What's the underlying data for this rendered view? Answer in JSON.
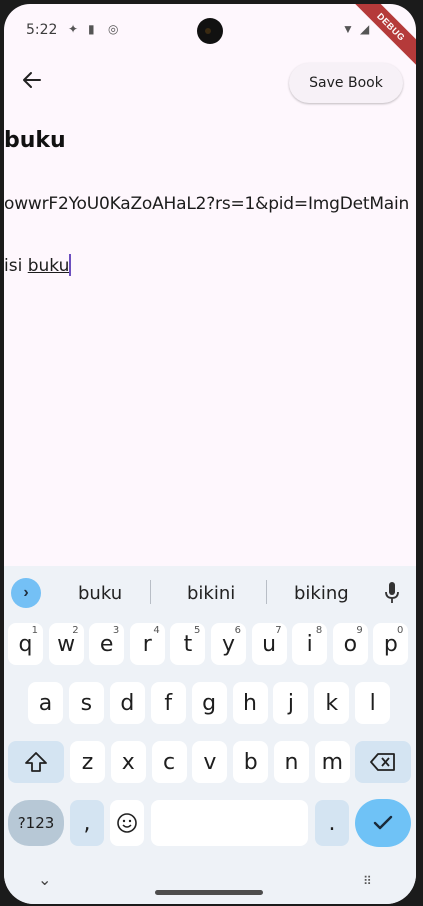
{
  "status_bar": {
    "time": "5:22",
    "debug_label": "DEBUG"
  },
  "appbar": {
    "save_label": "Save Book"
  },
  "book": {
    "title": "buku",
    "image_url": "owwrF2YoU0KaZoAHaL2?rs=1&pid=ImgDetMain",
    "content_prefix": "isi ",
    "content_word": "buku"
  },
  "keyboard": {
    "suggestions": [
      "buku",
      "bikini",
      "biking"
    ],
    "row1": [
      {
        "k": "q",
        "h": "1"
      },
      {
        "k": "w",
        "h": "2"
      },
      {
        "k": "e",
        "h": "3"
      },
      {
        "k": "r",
        "h": "4"
      },
      {
        "k": "t",
        "h": "5"
      },
      {
        "k": "y",
        "h": "6"
      },
      {
        "k": "u",
        "h": "7"
      },
      {
        "k": "i",
        "h": "8"
      },
      {
        "k": "o",
        "h": "9"
      },
      {
        "k": "p",
        "h": "0"
      }
    ],
    "row2": [
      "a",
      "s",
      "d",
      "f",
      "g",
      "h",
      "j",
      "k",
      "l"
    ],
    "row3": [
      "z",
      "x",
      "c",
      "v",
      "b",
      "n",
      "m"
    ],
    "symbols_label": "?123",
    "comma": ",",
    "period": "."
  },
  "colors": {
    "background": "#fef7fd",
    "accent": "#6fc2f6",
    "cursor": "#6c4fbf"
  }
}
